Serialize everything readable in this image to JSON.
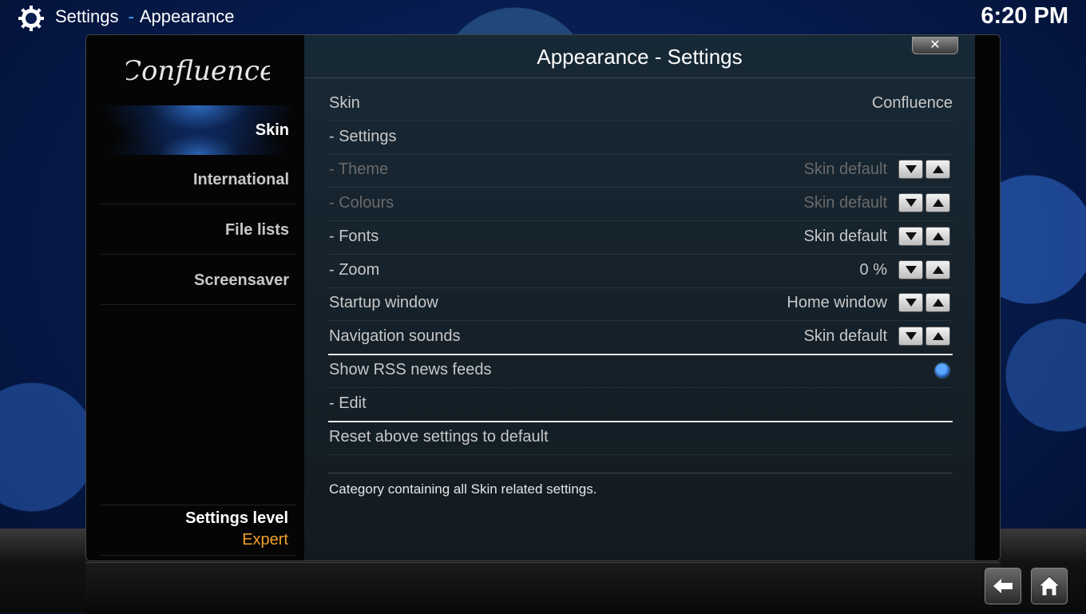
{
  "header": {
    "section": "Settings",
    "separator": "-",
    "page": "Appearance",
    "clock": "6:20 PM",
    "icon": "gear-icon"
  },
  "dialog": {
    "title": "Appearance - Settings",
    "close_label": "✕"
  },
  "logo_text": "Confluence",
  "sidebar": {
    "items": [
      {
        "label": "Skin",
        "active": true
      },
      {
        "label": "International"
      },
      {
        "label": "File lists"
      },
      {
        "label": "Screensaver"
      }
    ],
    "settings_level_label": "Settings level",
    "settings_level_value": "Expert",
    "level_color": "#f0a02a"
  },
  "settings": [
    {
      "label": "Skin",
      "value": "Confluence"
    },
    {
      "label": "- Settings",
      "value": ""
    },
    {
      "label": "- Theme",
      "value": "Skin default",
      "disabled": true
    },
    {
      "label": "- Colours",
      "value": "Skin default",
      "disabled": true
    },
    {
      "label": "- Fonts",
      "value": "Skin default"
    },
    {
      "label": "- Zoom",
      "value": "0 %"
    },
    {
      "label": "Startup window",
      "value": "Home window"
    },
    {
      "label": "Navigation sounds",
      "value": "Skin default"
    },
    {
      "label": "Show RSS news feeds",
      "toggle": true,
      "checked": true
    },
    {
      "label": "- Edit",
      "value": ""
    },
    {
      "label": "Reset above settings to default",
      "value": ""
    }
  ],
  "description": "Category containing all Skin related settings.",
  "footer": {
    "back_icon": "back-arrow-icon",
    "home_icon": "home-icon"
  }
}
